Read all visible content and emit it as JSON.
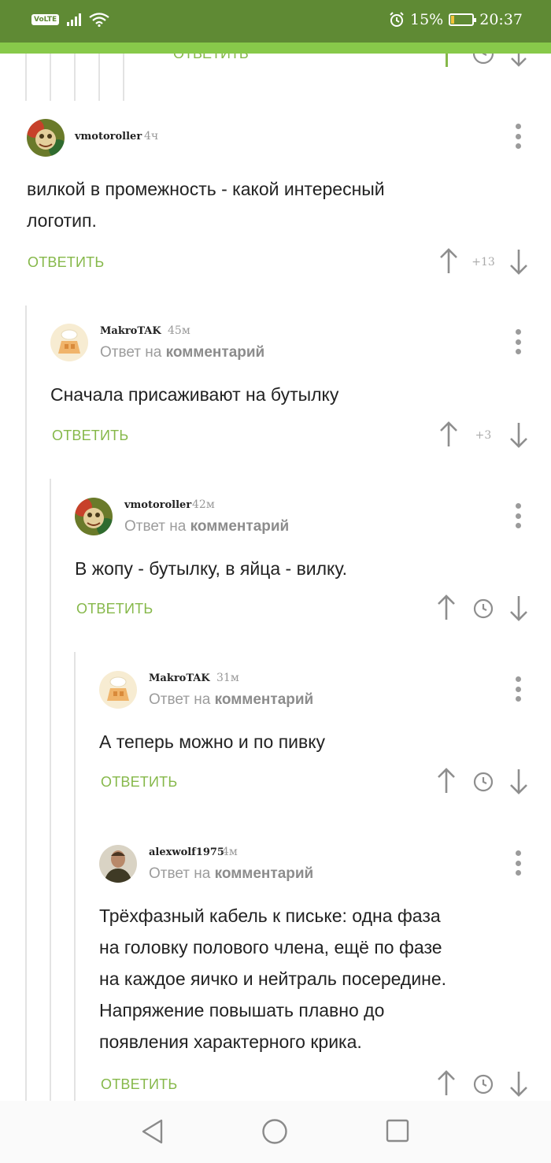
{
  "status_bar": {
    "network": "VoLTE",
    "battery_percent": "15%",
    "battery_level": 0.15,
    "time": "20:37"
  },
  "top_fragment": {
    "reply_label": "ОТВЕТИТЬ"
  },
  "comments": [
    {
      "username": "vmotoroller",
      "time": "4ч",
      "text": [
        "вилкой в промежность - какой интересный",
        "логотип."
      ],
      "reply_label": "ОТВЕТИТЬ",
      "score": "+13"
    },
    {
      "username": "MakroTAK",
      "time": "45м",
      "reply_to_prefix": "Ответ на",
      "reply_to_link": "комментарий",
      "text": [
        "Сначала присаживают на бутылку"
      ],
      "reply_label": "ОТВЕТИТЬ",
      "score": "+3"
    },
    {
      "username": "vmotoroller",
      "time": "42м",
      "reply_to_prefix": "Ответ на",
      "reply_to_link": "комментарий",
      "text": [
        "В жопу - бутылку, в яйца - вилку."
      ],
      "reply_label": "ОТВЕТИТЬ"
    },
    {
      "username": "MakroTAK",
      "time": "31м",
      "reply_to_prefix": "Ответ на",
      "reply_to_link": "комментарий",
      "text": [
        "А теперь можно и по пивку"
      ],
      "reply_label": "ОТВЕТИТЬ"
    },
    {
      "username": "alexwolf1975",
      "time": "4м",
      "reply_to_prefix": "Ответ на",
      "reply_to_link": "комментарий",
      "text": [
        "Трёхфазный кабель к письке: одна фаза",
        "на головку полового члена, ещё по фазе",
        "на каждое яичко и нейтраль посередине.",
        "Напряжение повышать плавно до",
        "появления характерного крика."
      ],
      "reply_label": "ОТВЕТИТЬ"
    }
  ],
  "colors": {
    "status_bar": "#5f8a34",
    "accent_green": "#86b84a",
    "progress_strip": "#88c94a"
  }
}
